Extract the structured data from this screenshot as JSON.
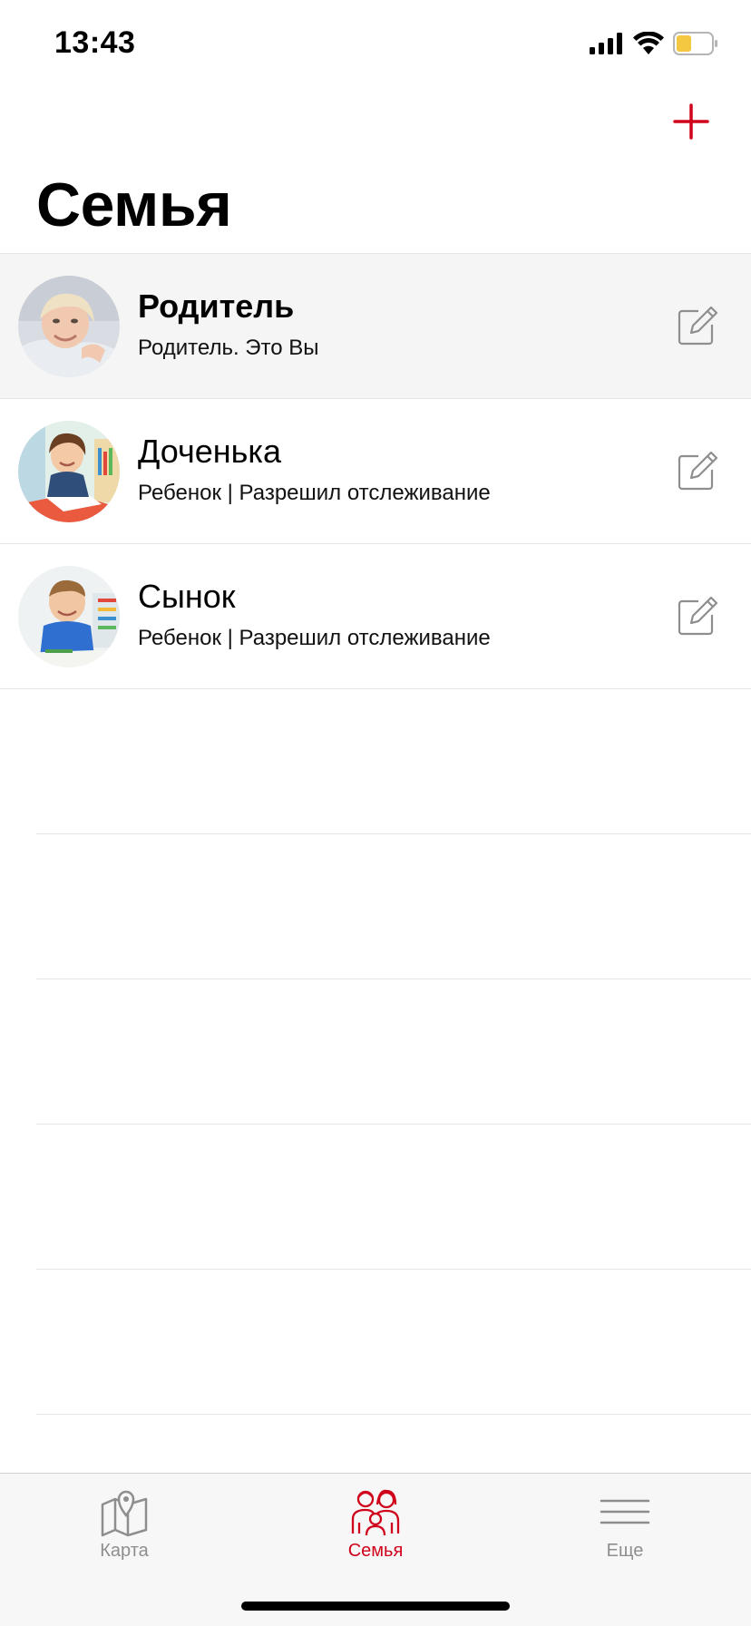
{
  "status_bar": {
    "time": "13:43",
    "icons": [
      "cellular-signal-icon",
      "wifi-icon",
      "battery-icon"
    ],
    "battery_color": "#f5c842"
  },
  "header": {
    "add_icon": "plus-icon",
    "title": "Семья"
  },
  "members": [
    {
      "name": "Родитель",
      "subtitle": "Родитель. Это Вы",
      "selected": true,
      "edit_icon": "edit-icon"
    },
    {
      "name": "Доченька",
      "subtitle": "Ребенок | Разрешил отслеживание",
      "selected": false,
      "edit_icon": "edit-icon"
    },
    {
      "name": "Сынок",
      "subtitle": "Ребенок | Разрешил отслеживание",
      "selected": false,
      "edit_icon": "edit-icon"
    }
  ],
  "tab_bar": {
    "tabs": [
      {
        "label": "Карта",
        "icon": "map-icon",
        "active": false
      },
      {
        "label": "Семья",
        "icon": "family-icon",
        "active": true
      },
      {
        "label": "Еще",
        "icon": "menu-icon",
        "active": false
      }
    ]
  },
  "colors": {
    "accent": "#d0021b",
    "inactive": "#8e8e8e",
    "selected_row": "#f5f5f5",
    "divider": "#e6e6e6"
  }
}
